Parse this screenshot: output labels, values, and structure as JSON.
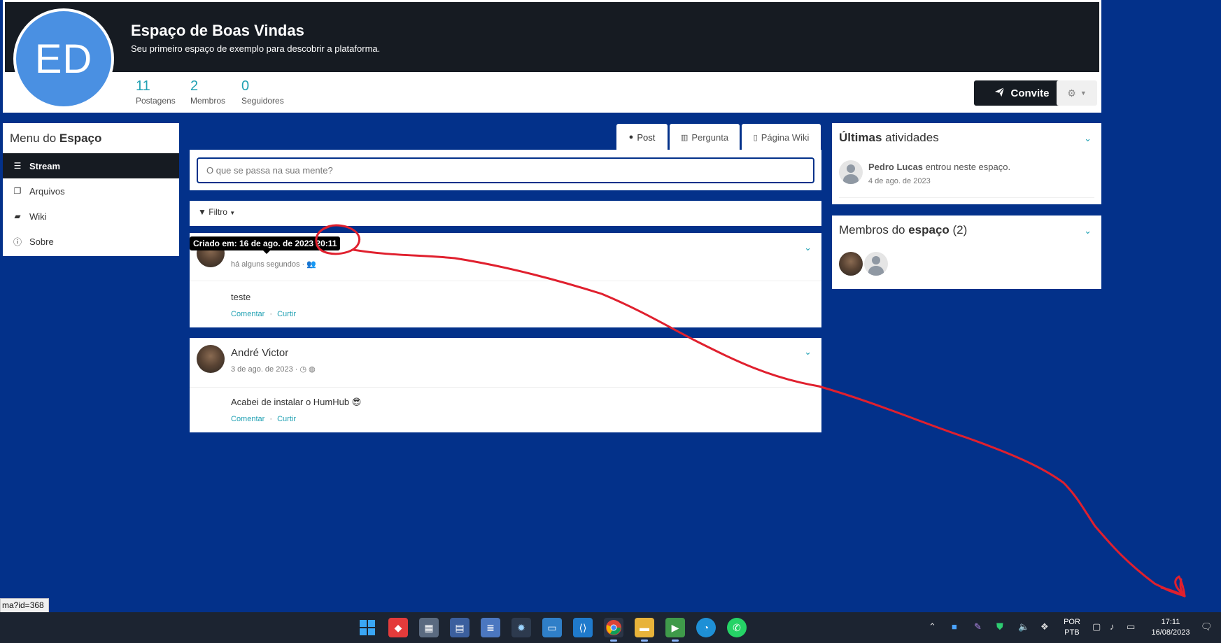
{
  "space": {
    "initials": "ED",
    "title": "Espaço de Boas Vindas",
    "description": "Seu primeiro espaço de exemplo para descobrir a plataforma.",
    "stats": [
      {
        "value": "11",
        "label": "Postagens"
      },
      {
        "value": "2",
        "label": "Membros"
      },
      {
        "value": "0",
        "label": "Seguidores"
      }
    ],
    "invite_label": "Convite"
  },
  "menu": {
    "title_prefix": "Menu do ",
    "title_bold": "Espaço",
    "items": [
      {
        "label": "Stream",
        "icon": "bars-icon"
      },
      {
        "label": "Arquivos",
        "icon": "files-icon"
      },
      {
        "label": "Wiki",
        "icon": "book-icon"
      },
      {
        "label": "Sobre",
        "icon": "info-icon"
      }
    ]
  },
  "composer": {
    "tabs": [
      {
        "label": "Post",
        "icon": "comment-icon"
      },
      {
        "label": "Pergunta",
        "icon": "chart-icon"
      },
      {
        "label": "Página Wiki",
        "icon": "page-icon"
      }
    ],
    "placeholder": "O que se passa na sua mente?"
  },
  "filter": {
    "label": "Filtro"
  },
  "tooltip": "Criado em: 16 de ago. de 2023 20:11",
  "posts": [
    {
      "author": "",
      "meta": "há alguns segundos ·",
      "content": "teste",
      "actions": {
        "comment": "Comentar",
        "like": "Curtir",
        "sep": "·"
      }
    },
    {
      "author": "André Victor",
      "meta": "3 de ago. de 2023 ·",
      "content": "Acabei de instalar o HumHub",
      "emoji": "😎",
      "actions": {
        "comment": "Comentar",
        "like": "Curtir",
        "sep": "·"
      }
    }
  ],
  "activity": {
    "title_bold": "Últimas",
    "title_rest": " atividades",
    "item": {
      "name": "Pedro Lucas",
      "text": " entrou neste espaço.",
      "date": "4 de ago. de 2023"
    }
  },
  "members": {
    "title_prefix": "Membros do ",
    "title_bold": "espaço",
    "title_count": " (2)"
  },
  "status_url": "ma?id=368",
  "taskbar": {
    "lang_top": "POR",
    "lang_bottom": "PTB",
    "time": "17:11",
    "date": "16/08/2023"
  },
  "colors": {
    "background": "#03318a",
    "banner": "#161b22",
    "accent": "#21a1b3",
    "avatar": "#4a90e2",
    "annotation": "#e0202e"
  }
}
